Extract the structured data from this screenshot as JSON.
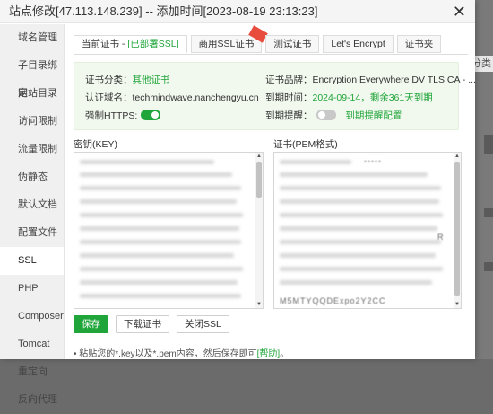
{
  "dialog": {
    "title": "站点修改[47.113.148.239] -- 添加时间[2023-08-19 23:13:23]",
    "close_icon": "close-icon"
  },
  "sidebar": {
    "items": [
      {
        "label": "域名管理"
      },
      {
        "label": "子目录绑定"
      },
      {
        "label": "网站目录"
      },
      {
        "label": "访问限制"
      },
      {
        "label": "流量限制"
      },
      {
        "label": "伪静态"
      },
      {
        "label": "默认文档"
      },
      {
        "label": "配置文件"
      },
      {
        "label": "SSL",
        "active": true
      },
      {
        "label": "PHP"
      },
      {
        "label": "Composer"
      },
      {
        "label": "Tomcat"
      },
      {
        "label": "重定向"
      },
      {
        "label": "反向代理"
      }
    ]
  },
  "tabs": [
    {
      "prefix": "当前证书 - ",
      "status": "[已部署SSL]",
      "active": true
    },
    {
      "prefix": "商用SSL证书",
      "status": "",
      "badge": true
    },
    {
      "prefix": "测试证书",
      "status": ""
    },
    {
      "prefix": "Let's Encrypt",
      "status": ""
    },
    {
      "prefix": "证书夹",
      "status": ""
    }
  ],
  "cert_info": {
    "type_label": "证书分类：",
    "type_value": "其他证书",
    "domain_label": "认证域名：",
    "domain_value": "techmindwave.nanchengyu.cn",
    "https_label": "强制HTTPS:",
    "https_enabled": true,
    "brand_label": "证书品牌：",
    "brand_value": "Encryption Everywhere DV TLS CA - ...",
    "expire_label": "到期时间：",
    "expire_value": "2024-09-14，剩余361天到期",
    "remind_label": "到期提醒：",
    "remind_enabled": false,
    "remind_link": "到期提醒配置"
  },
  "key_section": {
    "label": "密钥(KEY)"
  },
  "cert_section": {
    "label": "证书(PEM格式)",
    "fragment_top": "-----",
    "fragment_r": "R",
    "fragment_b": "M5MTYQQDExpo2Y2CC"
  },
  "buttons": {
    "save": "保存",
    "download": "下载证书",
    "close_ssl": "关闭SSL"
  },
  "hint": {
    "bullet": "•",
    "text": " 粘贴您的*.key以及*.pem内容，然后保存即可",
    "link": "[帮助]",
    "suffix": "。"
  },
  "background": {
    "tag": "分类"
  }
}
